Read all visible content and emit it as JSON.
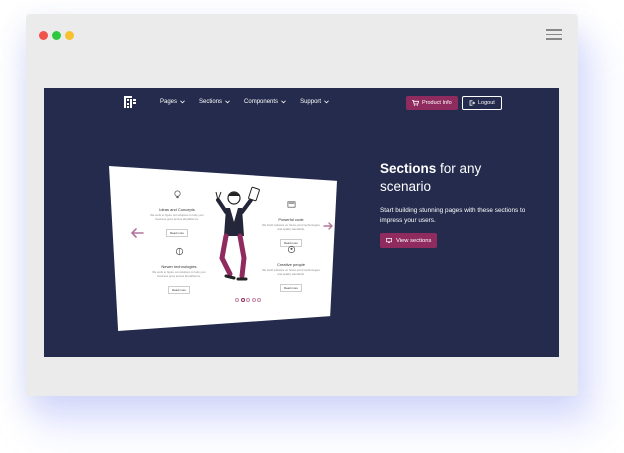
{
  "browser": {
    "dot_colors": [
      "#f1524c",
      "#2cc940",
      "#f7c131"
    ],
    "menu_icon": "hamburger-icon"
  },
  "nav": {
    "brand_icon": "logo-icon",
    "links": [
      {
        "label": "Pages"
      },
      {
        "label": "Sections"
      },
      {
        "label": "Components"
      },
      {
        "label": "Support"
      }
    ],
    "product_button": "Product Info",
    "logout_button": "Logout"
  },
  "hero": {
    "title_strong": "Sections",
    "title_rest": " for any scenario",
    "subtitle": "Start building stunning pages with these sections to impress your users.",
    "cta": "View sections"
  },
  "card": {
    "features": [
      {
        "title": "Ideas and Concepts",
        "desc": "We work to figure out solutions to help your business grow across all platforms.",
        "button": "Read more"
      },
      {
        "title": "Powerful code",
        "desc": "We build software on future-proof technologies and quality standards.",
        "button": "Read more"
      },
      {
        "title": "Newer technologies",
        "desc": "We work to figure out solutions to help your business grow across all platforms.",
        "button": "Read more"
      },
      {
        "title": "Creative people",
        "desc": "We build software on future-proof technologies and quality standards.",
        "button": "Read more"
      }
    ],
    "pager_count": 5,
    "pager_active": 2
  },
  "colors": {
    "hero_bg": "#242b4c",
    "accent": "#8f2b5e",
    "arrow": "#b0759b"
  }
}
